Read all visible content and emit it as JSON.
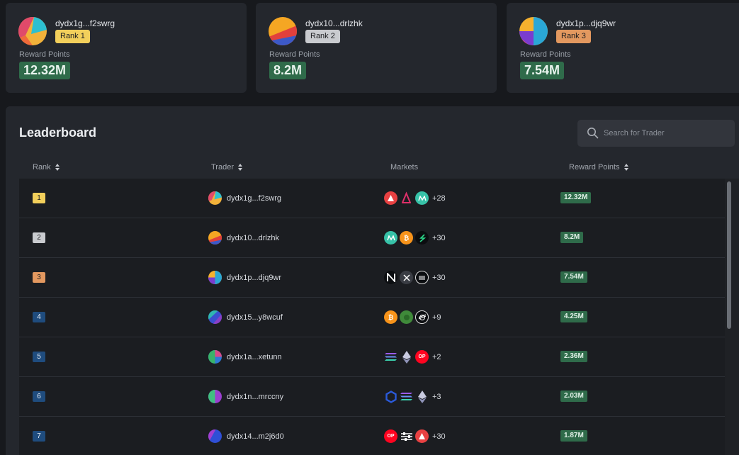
{
  "top_cards": [
    {
      "address": "dydx1g...f2swrg",
      "rank_label": "Rank 1",
      "points_label": "Reward Points",
      "points": "12.32M",
      "badge_color": "#f2cf5b"
    },
    {
      "address": "dydx10...drlzhk",
      "rank_label": "Rank 2",
      "points_label": "Reward Points",
      "points": "8.2M",
      "badge_color": "#c9cbcf"
    },
    {
      "address": "dydx1p...djq9wr",
      "rank_label": "Rank 3",
      "points_label": "Reward Points",
      "points": "7.54M",
      "badge_color": "#e3985f"
    }
  ],
  "leaderboard": {
    "title": "Leaderboard",
    "search_placeholder": "Search for Trader",
    "columns": {
      "rank": "Rank",
      "trader": "Trader",
      "markets": "Markets",
      "reward_points": "Reward Points"
    },
    "rows": [
      {
        "rank": "1",
        "address": "dydx1g...f2swrg",
        "markets": [
          "avax",
          "cake",
          "mana"
        ],
        "more": "+28",
        "points": "12.32M"
      },
      {
        "rank": "2",
        "address": "dydx10...drlzhk",
        "markets": [
          "mana",
          "btc",
          "sui"
        ],
        "more": "+30",
        "points": "8.2M"
      },
      {
        "rank": "3",
        "address": "dydx1p...djq9wr",
        "markets": [
          "near",
          "xrp",
          "eth-ring"
        ],
        "more": "+30",
        "points": "7.54M"
      },
      {
        "rank": "4",
        "address": "dydx15...y8wcuf",
        "markets": [
          "btc",
          "green-token",
          "xlm"
        ],
        "more": "+9",
        "points": "4.25M"
      },
      {
        "rank": "5",
        "address": "dydx1a...xetunn",
        "markets": [
          "sol",
          "eth",
          "op"
        ],
        "more": "+2",
        "points": "2.36M"
      },
      {
        "rank": "6",
        "address": "dydx1n...mrccny",
        "markets": [
          "link",
          "sol",
          "eth"
        ],
        "more": "+3",
        "points": "2.03M"
      },
      {
        "rank": "7",
        "address": "dydx14...m2j6d0",
        "markets": [
          "op",
          "sliders",
          "avax"
        ],
        "more": "+30",
        "points": "1.87M"
      }
    ]
  },
  "colors": {
    "rank1": "#f2cf5b",
    "rank2": "#c9cbcf",
    "rank3": "#e3985f",
    "rank_default": "#1f4c7e",
    "points_bg": "#2f6b4a"
  }
}
